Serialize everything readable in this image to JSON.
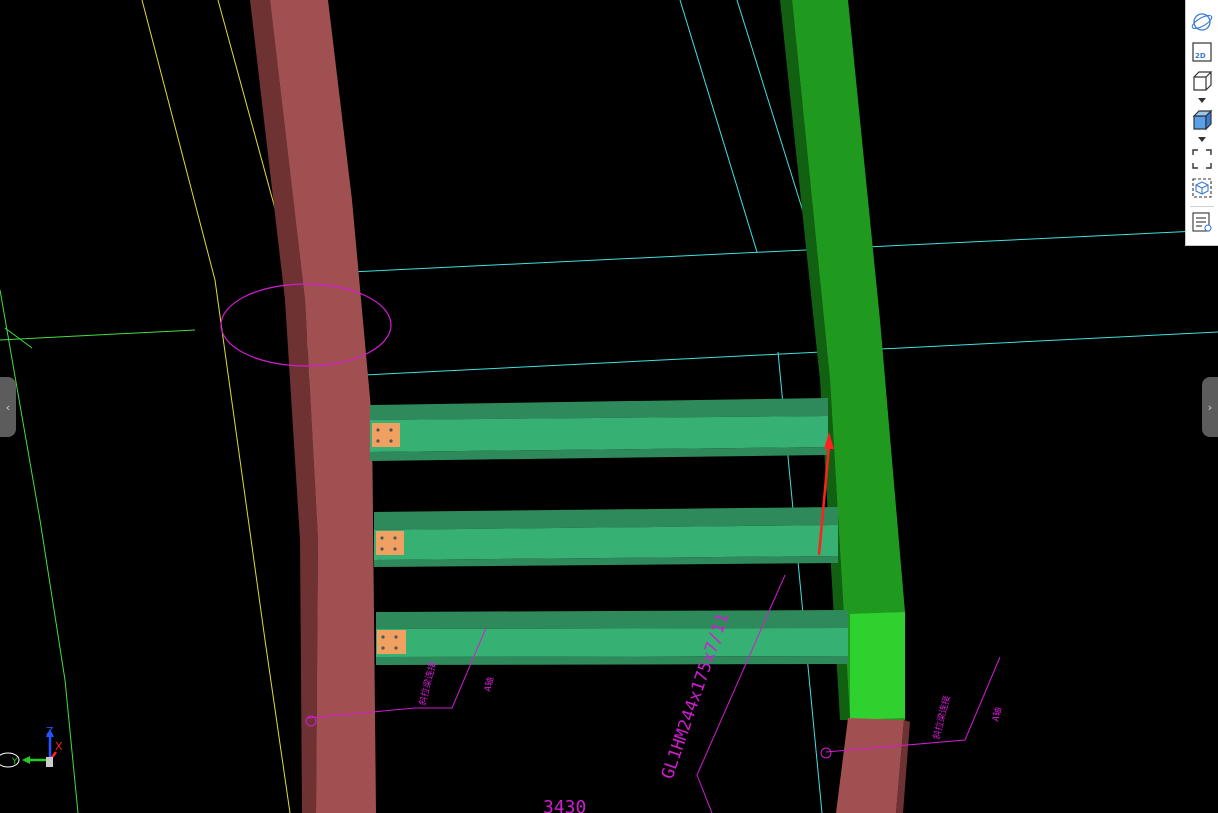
{
  "viewport": {
    "annotations": {
      "beam_label": "GL1HM244x175x7/11",
      "dimension": "3430",
      "note_left_a": "斜拉梁连接",
      "note_left_b": "A轴",
      "note_right_a": "斜拉梁连接",
      "note_right_b": "A轴"
    },
    "axis": {
      "z": "Z",
      "x": "X",
      "y": "Y"
    }
  },
  "toolbar": {
    "two_d_label": "2D",
    "icons": [
      "orbit-icon",
      "2d-view-icon",
      "wireframe-cube-icon",
      "view-dropdown-icon",
      "shaded-cube-icon",
      "shading-dropdown-icon",
      "fit-view-icon",
      "isolate-component-icon",
      "property-list-icon"
    ]
  },
  "side_tabs": {
    "left": "‹",
    "right": "›"
  },
  "colors": {
    "background": "#000000",
    "column_left": "#a05050",
    "column_right": "#1f9a1f",
    "beam": "#37b073",
    "connection_plate": "#f0a060",
    "grid_cyan": "#40e0e0",
    "grid_yellow": "#dddd33",
    "grid_green": "#44dd44",
    "annotation_magenta": "#d21cd2",
    "arrow_red": "#ff2020"
  }
}
